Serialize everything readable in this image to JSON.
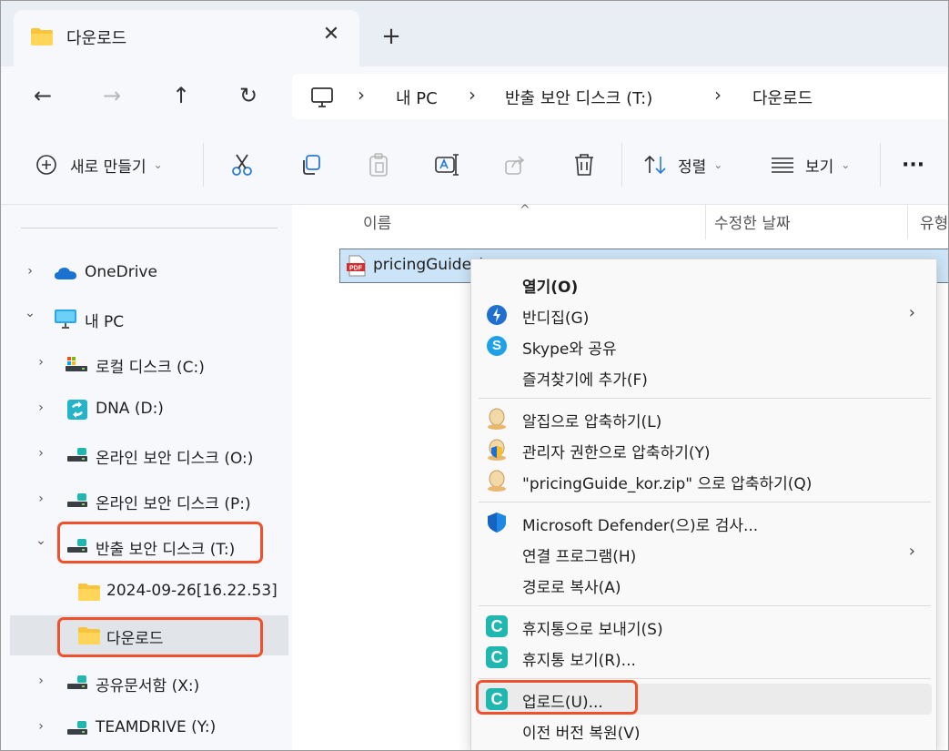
{
  "tab": {
    "title": "다운로드",
    "close": "✕",
    "new_tab": "+"
  },
  "nav": {
    "back": "←",
    "forward": "→",
    "up": "↑",
    "refresh": "↻"
  },
  "breadcrumb": [
    {
      "label": "내 PC"
    },
    {
      "label": "반출 보안 디스크 (T:)"
    },
    {
      "label": "다운로드"
    }
  ],
  "breadcrumb_sep": "›",
  "toolbar": {
    "new_label": "새로 만들기",
    "sort_label": "정렬",
    "view_label": "보기",
    "more_label": "···"
  },
  "sidebar": {
    "items": [
      {
        "label": "OneDrive",
        "arrow": "›",
        "icon": "onedrive-cloud-icon"
      },
      {
        "label": "내 PC",
        "arrow": "⌄",
        "icon": "monitor-icon"
      },
      {
        "label": "로컬 디스크 (C:)",
        "arrow": "›",
        "icon": "local-disk-icon"
      },
      {
        "label": "DNA (D:)",
        "arrow": "›",
        "icon": "sync-drive-icon"
      },
      {
        "label": "온라인 보안 디스크 (O:)",
        "arrow": "›",
        "icon": "secure-drive-icon"
      },
      {
        "label": "온라인 보안 디스크 (P:)",
        "arrow": "›",
        "icon": "secure-drive-icon"
      },
      {
        "label": "반출 보안 디스크 (T:)",
        "arrow": "⌄",
        "icon": "secure-drive-icon"
      },
      {
        "label": "2024-09-26[16.22.53]",
        "arrow": "",
        "icon": "folder-icon"
      },
      {
        "label": "다운로드",
        "arrow": "",
        "icon": "folder-icon"
      },
      {
        "label": "공유문서함 (X:)",
        "arrow": "›",
        "icon": "secure-drive-icon"
      },
      {
        "label": "TEAMDRIVE (Y:)",
        "arrow": "›",
        "icon": "secure-drive-icon"
      }
    ]
  },
  "columns": {
    "name": "이름",
    "modified": "수정한 날짜",
    "type": "유형"
  },
  "file": {
    "name": "pricingGuide_k"
  },
  "context_menu": {
    "items": [
      {
        "label": "열기(O)",
        "icon": ""
      },
      {
        "label": "반디집(G)",
        "icon": "bandizip-icon",
        "sub": "›"
      },
      {
        "label": "Skype와 공유",
        "icon": "skype-icon"
      },
      {
        "label": "즐겨찾기에 추가(F)",
        "icon": ""
      },
      {
        "label": "알집으로 압축하기(L)",
        "icon": "alzip-icon"
      },
      {
        "label": "관리자 권한으로 압축하기(Y)",
        "icon": "alzip-admin-icon"
      },
      {
        "label": "\"pricingGuide_kor.zip\" 으로 압축하기(Q)",
        "icon": "alzip-icon"
      },
      {
        "label": "Microsoft Defender(으)로 검사...",
        "icon": "defender-shield-icon"
      },
      {
        "label": "연결 프로그램(H)",
        "icon": "",
        "sub": "›"
      },
      {
        "label": "경로로 복사(A)",
        "icon": ""
      },
      {
        "label": "휴지통으로 보내기(S)",
        "icon": "c-app-icon"
      },
      {
        "label": "휴지통 보기(R)...",
        "icon": "c-app-icon"
      },
      {
        "label": "업로드(U)...",
        "icon": "c-app-icon"
      },
      {
        "label": "이전 버전 복원(V)",
        "icon": ""
      }
    ]
  },
  "icon_text": {
    "c_app": "C",
    "skype": "S",
    "pdf": "PDF"
  },
  "colors": {
    "highlight": "#f0502b",
    "selection": "#cce4f7",
    "c_app": "#1fb7b0"
  }
}
